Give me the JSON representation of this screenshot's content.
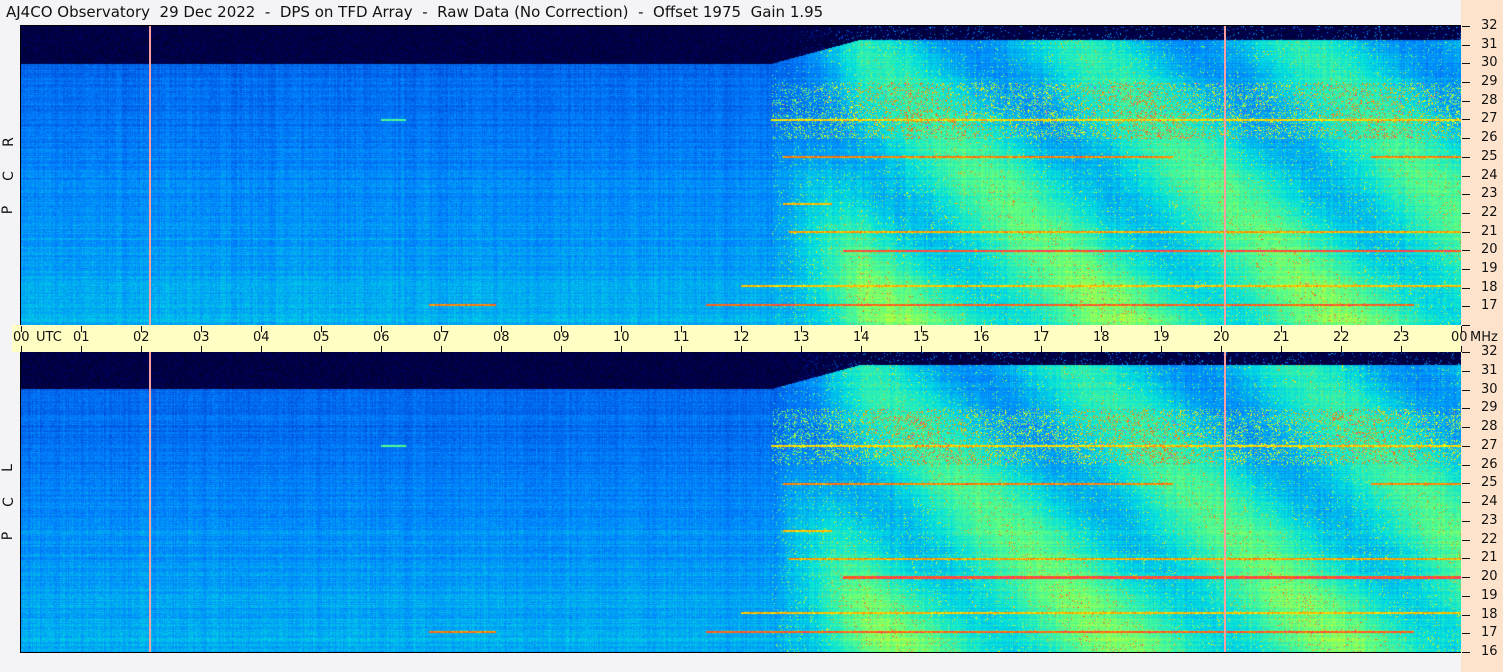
{
  "title": "AJ4CO Observatory  29 Dec 2022  -  DPS on TFD Array  -  Raw Data (No Correction)  -  Offset 1975  Gain 1.95",
  "chart_data": {
    "type": "heatmap",
    "title": "AJ4CO Observatory  29 Dec 2022  -  DPS on TFD Array  -  Raw Data (No Correction)  -  Offset 1975  Gain 1.95",
    "xlabel": "UTC",
    "ylabel": "MHz",
    "x_range": [
      0,
      24
    ],
    "y_range": [
      16,
      32
    ],
    "x_ticks": [
      "00",
      "01",
      "02",
      "03",
      "04",
      "05",
      "06",
      "07",
      "08",
      "09",
      "10",
      "11",
      "12",
      "13",
      "14",
      "15",
      "16",
      "17",
      "18",
      "19",
      "20",
      "21",
      "22",
      "23",
      "00"
    ],
    "x_unit_label": "UTC",
    "y_unit_label": "MHz",
    "y_ticks": [
      32,
      31,
      30,
      29,
      28,
      27,
      26,
      25,
      24,
      23,
      22,
      21,
      20,
      19,
      18,
      17,
      16
    ],
    "panels": [
      {
        "name": "RCP",
        "label": [
          "R",
          "C",
          "P"
        ]
      },
      {
        "name": "LCP",
        "label": [
          "L",
          "C",
          "P"
        ]
      }
    ],
    "markers_utc": [
      2.15,
      20.07
    ],
    "night_cutoff_mhz": 30,
    "day_start_utc": 12.5,
    "interference_lines": [
      {
        "freq": 17.1,
        "start": 6.8,
        "end": 7.9,
        "level": 0.85
      },
      {
        "freq": 17.1,
        "start": 11.4,
        "end": 23.2,
        "level": 0.88
      },
      {
        "freq": 18.1,
        "start": 12.0,
        "end": 24.0,
        "level": 0.8
      },
      {
        "freq": 20.0,
        "start": 13.7,
        "end": 24.0,
        "level": 0.9
      },
      {
        "freq": 21.0,
        "start": 12.8,
        "end": 24.0,
        "level": 0.82
      },
      {
        "freq": 22.5,
        "start": 12.7,
        "end": 13.5,
        "level": 0.8
      },
      {
        "freq": 25.0,
        "start": 12.7,
        "end": 19.2,
        "level": 0.85
      },
      {
        "freq": 25.0,
        "start": 22.5,
        "end": 24.0,
        "level": 0.85
      },
      {
        "freq": 27.0,
        "start": 12.5,
        "end": 24.0,
        "level": 0.78
      },
      {
        "freq": 27.0,
        "start": 6.0,
        "end": 6.4,
        "level": 0.6
      }
    ],
    "colormap": [
      "#000000",
      "#000060",
      "#0030c0",
      "#0080ff",
      "#00e0e0",
      "#60ff80",
      "#ffff00",
      "#ff6000",
      "#ff00ff"
    ]
  }
}
